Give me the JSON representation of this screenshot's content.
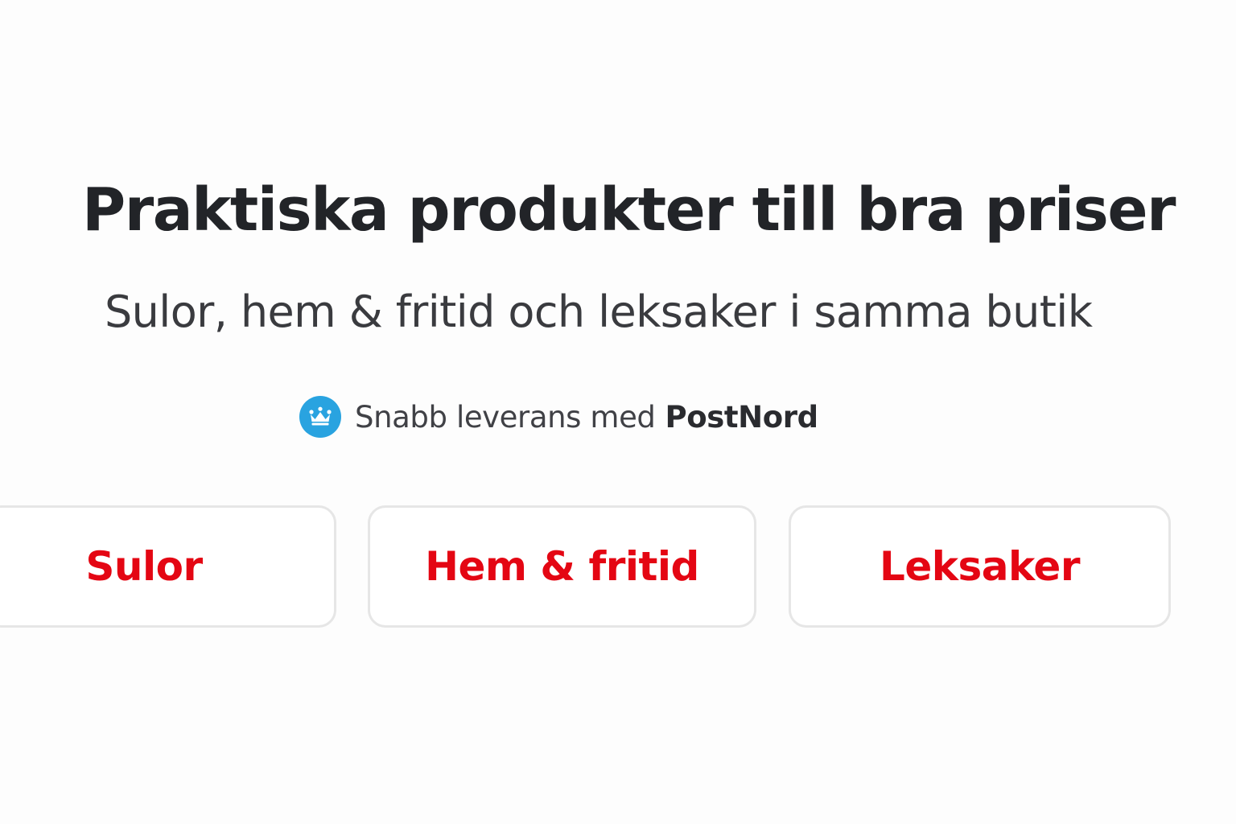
{
  "hero": {
    "title": "Praktiska produkter till bra priser",
    "subtitle": "Sulor, hem & fritid och leksaker i samma butik"
  },
  "delivery": {
    "icon": "crown-icon",
    "icon_color": "#29a3e0",
    "text": "Snabb leverans med",
    "brand": "PostNord"
  },
  "categories": [
    {
      "label": "Sulor"
    },
    {
      "label": "Hem & fritid"
    },
    {
      "label": "Leksaker"
    }
  ],
  "colors": {
    "accent": "#e40613",
    "border": "#e6e6e6"
  }
}
